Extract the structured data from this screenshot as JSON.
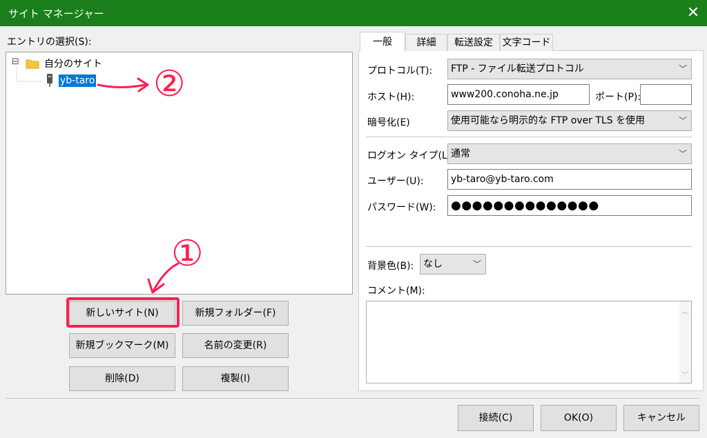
{
  "window": {
    "title": "サイト マネージャー",
    "close_glyph": "✕"
  },
  "entries": {
    "label": "エントリの選択(S):",
    "root": {
      "expander": "⊟",
      "label": "自分のサイト"
    },
    "site": {
      "label": "yb-taro"
    }
  },
  "buttons": {
    "new_site": "新しいサイト(N)",
    "new_folder": "新規フォルダー(F)",
    "new_bookmark": "新規ブックマーク(M)",
    "rename": "名前の変更(R)",
    "delete": "削除(D)",
    "duplicate": "複製(I)",
    "connect": "接続(C)",
    "ok": "OK(O)",
    "cancel": "キャンセル"
  },
  "tabs": [
    "一般",
    "詳細",
    "転送設定",
    "文字コード"
  ],
  "general": {
    "protocol_label": "プロトコル(T):",
    "protocol_value": "FTP - ファイル転送プロトコル",
    "host_label": "ホスト(H):",
    "host_value": "www200.conoha.ne.jp",
    "port_label": "ポート(P):",
    "port_value": "",
    "encryption_label": "暗号化(E)",
    "encryption_value": "使用可能なら明示的な FTP over TLS を使用",
    "logon_label": "ログオン タイプ(L):",
    "logon_value": "通常",
    "user_label": "ユーザー(U):",
    "user_value": "yb-taro@yb-taro.com",
    "password_label": "パスワード(W):",
    "password_value": "●●●●●●●●●●●●●●",
    "bgcolor_label": "背景色(B):",
    "bgcolor_value": "なし",
    "comment_label": "コメント(M):"
  },
  "annotations": {
    "one": "①",
    "two": "②"
  },
  "colors": {
    "titlebar": "#1a7f1a",
    "selection": "#0078d7",
    "annotation": "#ff1e50"
  }
}
